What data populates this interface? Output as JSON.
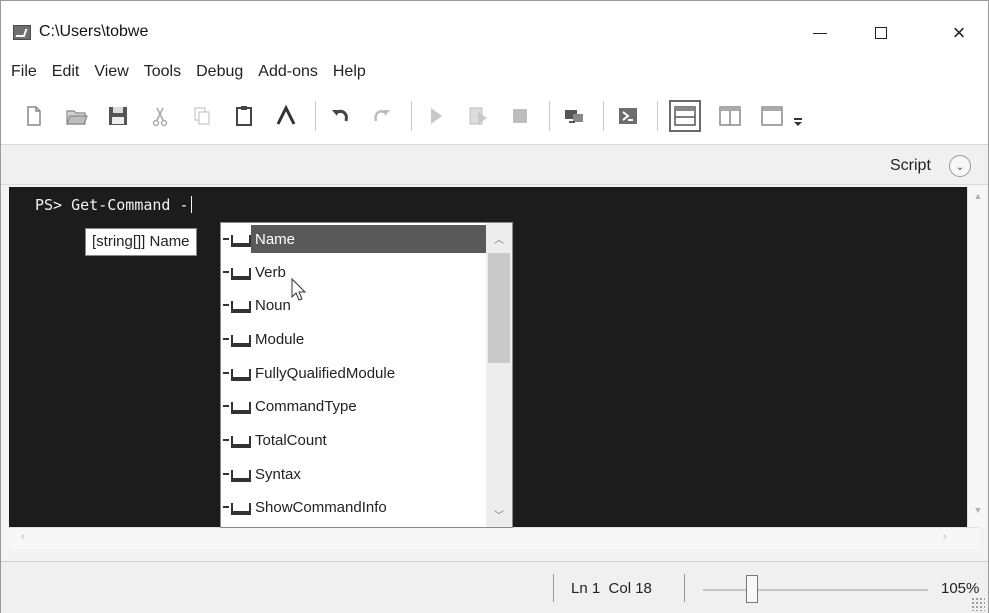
{
  "window": {
    "title": "C:\\Users\\tobwe",
    "controls": [
      "minimize",
      "maximize",
      "close"
    ]
  },
  "menubar": {
    "items": [
      "File",
      "Edit",
      "View",
      "Tools",
      "Debug",
      "Add-ons",
      "Help"
    ]
  },
  "toolbar": {
    "buttons": [
      "new-icon",
      "open-icon",
      "save-icon",
      "cut-icon",
      "copy-icon",
      "paste-icon",
      "run-icon",
      "undo-icon",
      "redo-icon",
      "run-script-icon",
      "run-selection-icon",
      "stop-icon",
      "remote-icon",
      "powershell-icon",
      "layout-top-icon",
      "layout-right-icon",
      "layout-max-icon",
      "overflow-icon"
    ],
    "active_layout": "layout-top-icon"
  },
  "script_pane": {
    "label": "Script"
  },
  "console": {
    "prompt": "PS>",
    "command": "Get-Command -"
  },
  "tooltip": {
    "text": "[string[]] Name"
  },
  "intellisense": {
    "selected_index": 0,
    "items": [
      "Name",
      "Verb",
      "Noun",
      "Module",
      "FullyQualifiedModule",
      "CommandType",
      "TotalCount",
      "Syntax",
      "ShowCommandInfo"
    ]
  },
  "statusbar": {
    "position": "Ln 1  Col 18",
    "zoom": "105%",
    "zoom_slider_fraction": 0.2
  },
  "colors": {
    "console_background": "#1c1c1c",
    "console_text": "#f2f2f2",
    "selection": "#595959"
  }
}
